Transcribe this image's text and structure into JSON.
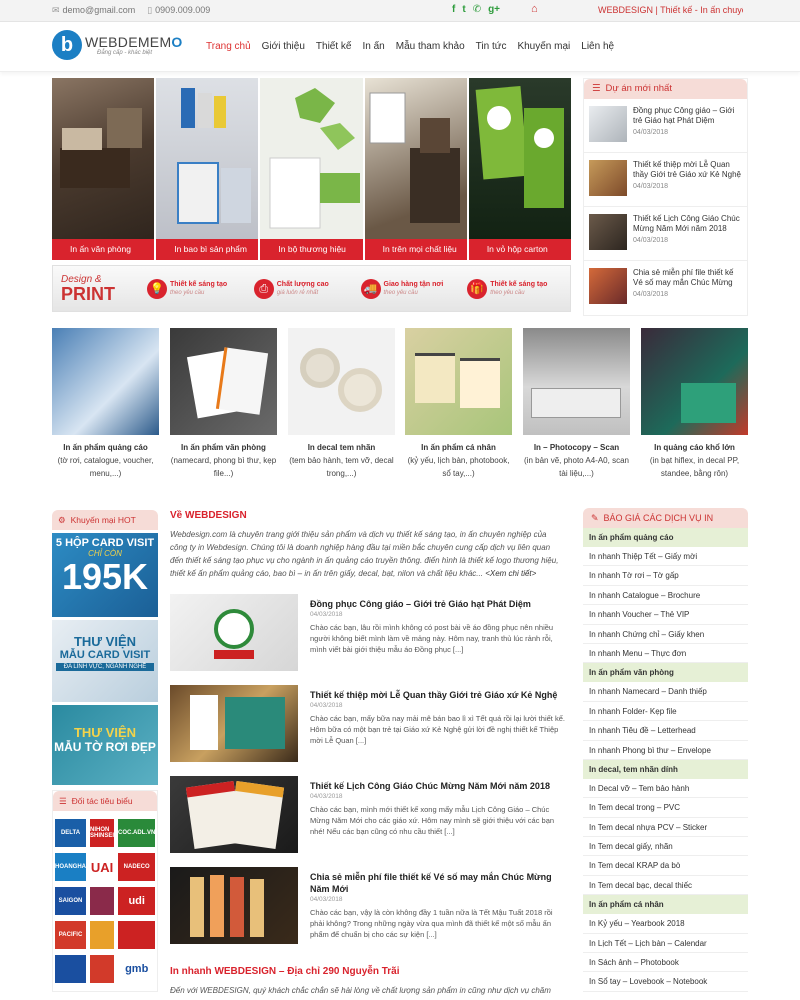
{
  "topbar": {
    "email": "demo@gmail.com",
    "phone": "0909.009.009",
    "social": [
      "f",
      "t",
      "g+"
    ],
    "marquee": "WEBDESIGN | Thiết kế - In ấn chuyên ng"
  },
  "header": {
    "logo_mark": "b",
    "logo_name_a": "WEBDEMEM",
    "logo_name_b": "O",
    "logo_tag": "Đẳng cấp - khác biệt",
    "nav": [
      "Trang chủ",
      "Giới thiệu",
      "Thiết kế",
      "In ấn",
      "Mẫu tham khảo",
      "Tin tức",
      "Khuyến mại",
      "Liên hệ"
    ]
  },
  "banner": {
    "cells": [
      {
        "label": "In ấn văn phòng",
        "bg": "#5a4a3c"
      },
      {
        "label": "In bao bì sản phẩm",
        "bg": "#c9ccd2"
      },
      {
        "label": "In bộ thương hiệu",
        "bg": "#eef0ea"
      },
      {
        "label": "In trên mọi chất liệu",
        "bg": "#6b5a48"
      },
      {
        "label": "In vỏ hộp carton",
        "bg": "#1a3a1a"
      }
    ],
    "design_top": "Design &",
    "design_bottom": "PRINT",
    "features": [
      {
        "title": "Thiết kế sáng tạo",
        "sub": "theo yêu cầu",
        "icon": "💡"
      },
      {
        "title": "Chất lượng cao",
        "sub": "giá luôn rẻ nhất",
        "icon": "⎙"
      },
      {
        "title": "Giao hàng tận nơi",
        "sub": "theo yêu cầu",
        "icon": "🚚"
      },
      {
        "title": "Thiết kế sáng tạo",
        "sub": "theo yêu cầu",
        "icon": "🎁"
      }
    ]
  },
  "latest": {
    "title": "Dự án mới nhất",
    "items": [
      {
        "title": "Đồng phục Công giáo – Giới trẻ Giáo hạt Phát Diệm",
        "date": "04/03/2018"
      },
      {
        "title": "Thiết kế thiệp mời Lễ Quan thầy Giới trẻ Giáo xứ Kẻ Nghệ",
        "date": "04/03/2018"
      },
      {
        "title": "Thiết kế Lịch Công Giáo Chúc Mừng Năm Mới năm 2018",
        "date": "04/03/2018"
      },
      {
        "title": "Chia sẻ miễn phí file thiết kế Vé số may mắn Chúc Mừng",
        "date": "04/03/2018"
      }
    ]
  },
  "products": [
    {
      "name": "In ấn phẩm quảng cáo",
      "desc": "(tờ rơi, catalogue, voucher, menu,...)"
    },
    {
      "name": "In ấn phẩm văn phòng",
      "desc": "(namecard, phong bì thư, kẹp file...)"
    },
    {
      "name": "In decal tem nhãn",
      "desc": "(tem bảo hành, tem vỡ, decal trong,...)"
    },
    {
      "name": "In ấn phẩm cá nhân",
      "desc": "(kỷ yếu, lịch bàn, photobook, sổ tay,...)"
    },
    {
      "name": "In – Photocopy – Scan",
      "desc": "(in bản vẽ, photo A4-A0, scan tài liệu,...)"
    },
    {
      "name": "In quảng cáo khổ lớn",
      "desc": "(in bạt hiflex, in decal PP, standee, bằng rôn)"
    }
  ],
  "promo": {
    "title": "Khuyến mại HOT",
    "card1": {
      "line1": "5 HỘP CARD VISIT",
      "line2": "CHỈ CÒN",
      "line3": "195K"
    },
    "card2": {
      "line1": "THƯ VIỆN",
      "line2": "MẪU CARD VISIT",
      "line3": "ĐA LĨNH VỰC, NGÀNH NGHỀ"
    },
    "card3": {
      "line1": "THƯ VIỆN",
      "line2": "MẪU TỜ RƠI ĐẸP"
    }
  },
  "partners": {
    "title": "Đối tác tiêu biểu",
    "logos": [
      "DELTA",
      "NIHON SHINSEI",
      "COC.ADL.VN",
      "HOANGHA",
      "UAI",
      "NADECO",
      "SAIGON",
      "",
      "udi",
      "PACIFIC",
      "",
      "",
      "",
      "",
      "gmb"
    ]
  },
  "about": {
    "title": "Về WEBDESIGN",
    "text": "Webdesign.com là chuyên trang giới thiệu sản phẩm và dịch vụ thiết kế sáng tạo, in ấn chuyên nghiệp của công ty in Webdesign. Chúng tôi là doanh nghiệp hàng đầu tại miền bắc chuyên cung cấp dịch vụ liên quan đến thiết kế sáng tạo phục vụ cho ngành in ấn quảng cáo truyền thông. điển hình là thiết kế logo thương hiệu, thiết kế ấn phẩm quảng cáo, bao bì – in ấn trên giấy, decal, bạt, nilon và chất liệu khác...",
    "more": "<Xem chi tiết>"
  },
  "posts": [
    {
      "title": "Đồng phục Công giáo – Giới trẻ Giáo hạt Phát Diệm",
      "date": "04/03/2018",
      "excerpt": "Chào các bạn, lâu rồi mình không có post bài về áo đồng phục nên nhiều người không biết mình làm về mảng này. Hôm nay, tranh thủ lúc rảnh rỗi, mình viết bài giới thiệu mẫu áo Đồng phục [...]"
    },
    {
      "title": "Thiết kế thiệp mời Lễ Quan thầy Giới trẻ Giáo xứ Kẻ Nghệ",
      "date": "04/03/2018",
      "excerpt": "Chào các bạn, mấy bữa nay mải mê bán bao lì xì Tết quá rồi lại lười thiết kế. Hôm bữa có một bạn trẻ tại Giáo xứ Kẻ Nghệ gửi lời đề nghị thiết kế Thiệp mời Lễ Quan [...]"
    },
    {
      "title": "Thiết kế Lịch Công Giáo Chúc Mừng Năm Mới năm 2018",
      "date": "04/03/2018",
      "excerpt": "Chào các bạn, mình mới thiết kế xong mấy mẫu Lịch Công Giáo – Chúc Mừng Năm Mới cho các giáo xứ. Hôm nay mình sẽ giới thiệu với các bạn nhé! Nếu các bạn cũng có nhu cầu thiết [...]"
    },
    {
      "title": "Chia sẻ miễn phí file thiết kế Vé số may mắn Chúc Mừng Năm Mới",
      "date": "04/03/2018",
      "excerpt": "Chào các bạn, vậy là còn không đầy 1 tuần nữa là Tết Mậu Tuất 2018 rồi phải không? Trong những ngày vừa qua mình đã thiết kế một số mẫu ấn phẩm để chuẩn bị cho các sự kiện [...]"
    }
  ],
  "address": {
    "title": "In nhanh WEBDESIGN – Địa chỉ 290 Nguyễn Trãi",
    "text": "Đến với WEBDESIGN, quý khách chắc chắn sẽ hài lòng về chất lượng sản phẩm in cũng như dịch vụ chăm"
  },
  "pricelist": {
    "title": "BÁO GIÁ CÁC DỊCH VỤ IN",
    "groups": [
      {
        "name": "In ấn phẩm quảng cáo",
        "items": [
          "In nhanh Thiệp Tết – Giấy mời",
          "In nhanh Tờ rơi – Tờ gấp",
          "In nhanh Catalogue – Brochure",
          "In nhanh Voucher – Thẻ VIP",
          "In nhanh Chứng chỉ – Giấy khen",
          "In nhanh Menu – Thực đơn"
        ]
      },
      {
        "name": "In ấn phẩm văn phòng",
        "items": [
          "In nhanh Namecard – Danh thiếp",
          "In nhanh Folder- Kẹp file",
          "In nhanh Tiêu đề – Letterhead",
          "In nhanh Phong bì thư – Envelope"
        ]
      },
      {
        "name": "In decal, tem nhãn dính",
        "items": [
          "In Decal vỡ – Tem bảo hành",
          "In Tem decal trong – PVC",
          "In Tem decal nhựa PCV – Sticker",
          "In Tem decal giấy, nhãn",
          "In Tem decal KRAP da bò",
          "In Tem decal bạc, decal thiếc"
        ]
      },
      {
        "name": "In ấn phẩm cá nhân",
        "items": [
          "In Kỷ yếu – Yearbook 2018",
          "In Lịch Tết – Lịch bàn – Calendar",
          "In Sách ảnh – Photobook",
          "In Sổ tay – Lovebook – Notebook"
        ]
      }
    ]
  }
}
